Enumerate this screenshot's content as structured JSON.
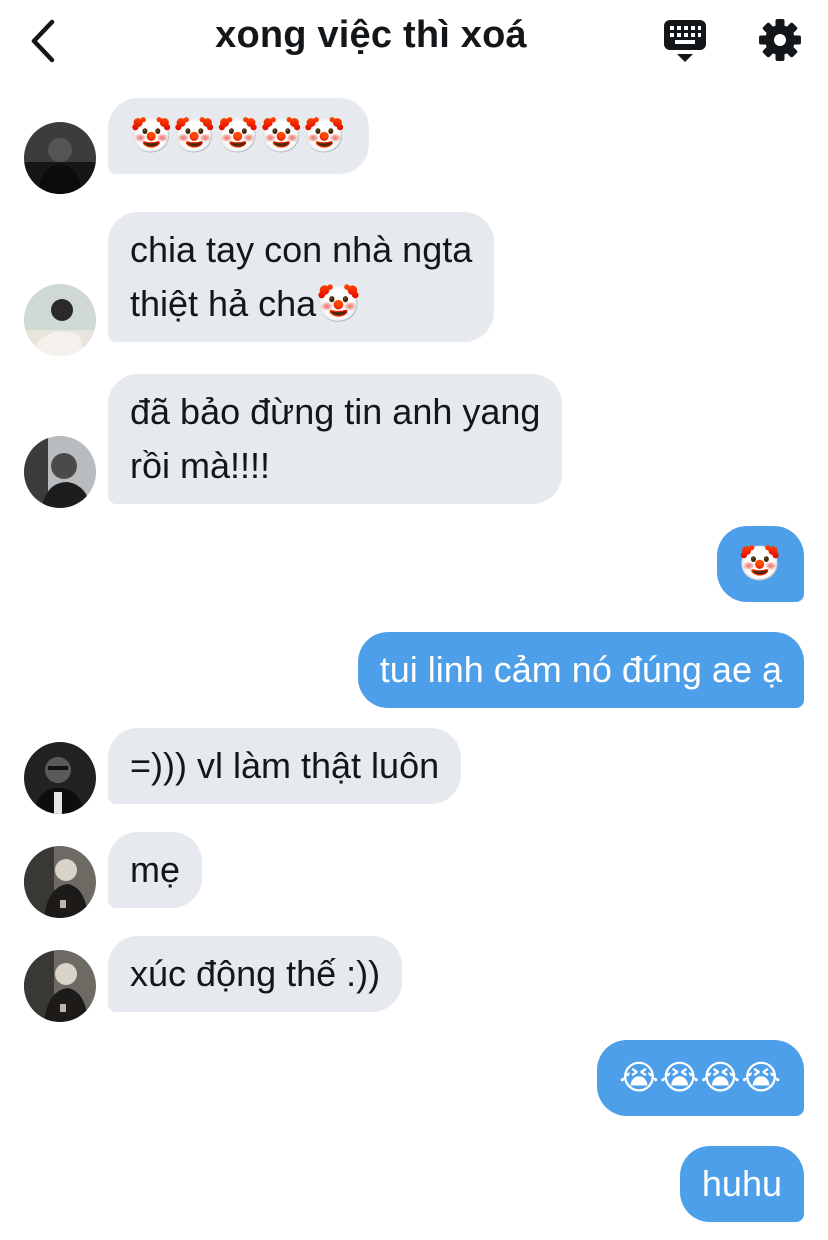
{
  "header": {
    "title": "xong việc thì xoá",
    "back_icon": "chevron-left-icon",
    "keyboard_icon": "keyboard-icon",
    "settings_icon": "gear-icon"
  },
  "colors": {
    "incoming_bubble": "#e6eaee",
    "outgoing_bubble": "#4c9fe8",
    "text": "#14171a"
  },
  "messages": [
    {
      "side": "in",
      "text": "🤡🤡🤡🤡🤡"
    },
    {
      "side": "in",
      "text": "chia tay con nhà ngta\nthiệt hả cha🤡"
    },
    {
      "side": "in",
      "text": "đã bảo đừng tin anh yang\nrồi mà!!!!"
    },
    {
      "side": "out",
      "text": "🤡"
    },
    {
      "side": "out",
      "text": "tui linh cảm nó đúng ae ạ"
    },
    {
      "side": "in",
      "text": "=))) vl làm thật luôn"
    },
    {
      "side": "in",
      "text": "mẹ"
    },
    {
      "side": "in",
      "text": "xúc động thế :))"
    },
    {
      "side": "out",
      "text": "😭😭😭😭"
    },
    {
      "side": "out",
      "text": "huhu"
    }
  ]
}
